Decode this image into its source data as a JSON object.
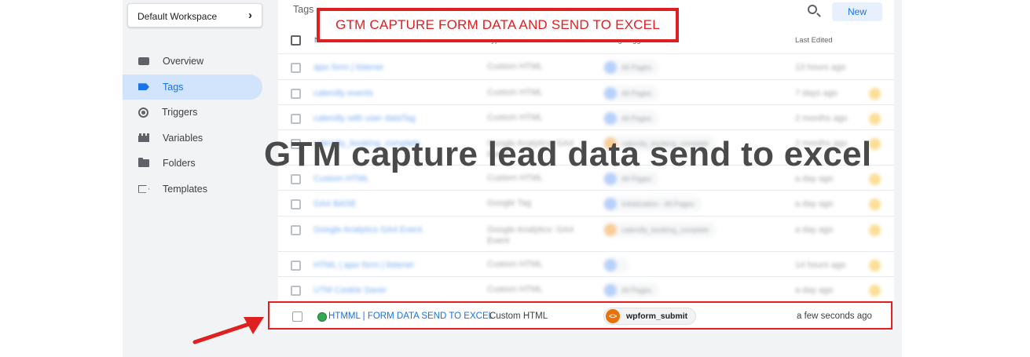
{
  "workspace": {
    "label": "Default Workspace",
    "chevron_icon": "chevron-right-icon"
  },
  "sidebar": {
    "items": [
      {
        "label": "Overview",
        "icon": "overview-icon",
        "active": false
      },
      {
        "label": "Tags",
        "icon": "tag-icon",
        "active": true
      },
      {
        "label": "Triggers",
        "icon": "trigger-icon",
        "active": false
      },
      {
        "label": "Variables",
        "icon": "variables-icon",
        "active": false
      },
      {
        "label": "Folders",
        "icon": "folder-icon",
        "active": false
      },
      {
        "label": "Templates",
        "icon": "template-icon",
        "active": false
      }
    ]
  },
  "main": {
    "title": "Tags",
    "new_label": "New",
    "columns": {
      "name": "Name ↑",
      "type": "Type",
      "triggers": "Firing Triggers",
      "edited": "Last Edited"
    },
    "blurred_rows": [
      {
        "name": "ajax form | listener",
        "type": "Custom HTML",
        "trigger": "All Pages",
        "edited": "13 hours ago",
        "trigger_color": "blue",
        "status": ""
      },
      {
        "name": "calendly events",
        "type": "Custom HTML",
        "trigger": "All Pages",
        "edited": "7 days ago",
        "trigger_color": "blue",
        "status": "paused"
      },
      {
        "name": "calendly with user dataTag",
        "type": "Custom HTML",
        "trigger": "All Pages",
        "edited": "2 months ago",
        "trigger_color": "blue",
        "status": "modified"
      },
      {
        "name": "calendly_booking_complete",
        "type": "Google Analytics: GA4 Event",
        "trigger": "calendly_booking_complete",
        "edited": "2 months ago",
        "trigger_color": "orange",
        "status": "modified"
      },
      {
        "name": "Custom HTML",
        "type": "Custom HTML",
        "trigger": "All Pages",
        "edited": "a day ago",
        "trigger_color": "blue",
        "status": "modified"
      },
      {
        "name": "GA4 BASE",
        "type": "Google Tag",
        "trigger": "Initialization - All Pages",
        "edited": "a day ago",
        "trigger_color": "blue",
        "status": "modified"
      },
      {
        "name": "Google Analytics GA4 Event",
        "type": "Google Analytics: GA4 Event",
        "trigger": "calendly_booking_complete",
        "edited": "a day ago",
        "trigger_color": "orange",
        "status": "modified"
      },
      {
        "name": "HTML | ajax form | listener",
        "type": "Custom HTML",
        "trigger": "",
        "edited": "14 hours ago",
        "trigger_color": "blue",
        "status": "modified"
      },
      {
        "name": "UTM Cookie Saver",
        "type": "Custom HTML",
        "trigger": "All Pages",
        "edited": "a day ago",
        "trigger_color": "blue",
        "status": "modified"
      }
    ],
    "highlight_row": {
      "name": "HTMML | FORM DATA SEND TO EXCEL",
      "type": "Custom HTML",
      "trigger": "wpform_submit",
      "trigger_icon": "code-icon",
      "edited": "a few seconds ago"
    }
  },
  "annotation": {
    "box_title": "GTM CAPTURE FORM DATA AND SEND TO EXCEL",
    "overlay_title": "GTM capture lead data send to excel",
    "accent_red": "#e02020",
    "overlay_color": "#4a4a4a"
  }
}
